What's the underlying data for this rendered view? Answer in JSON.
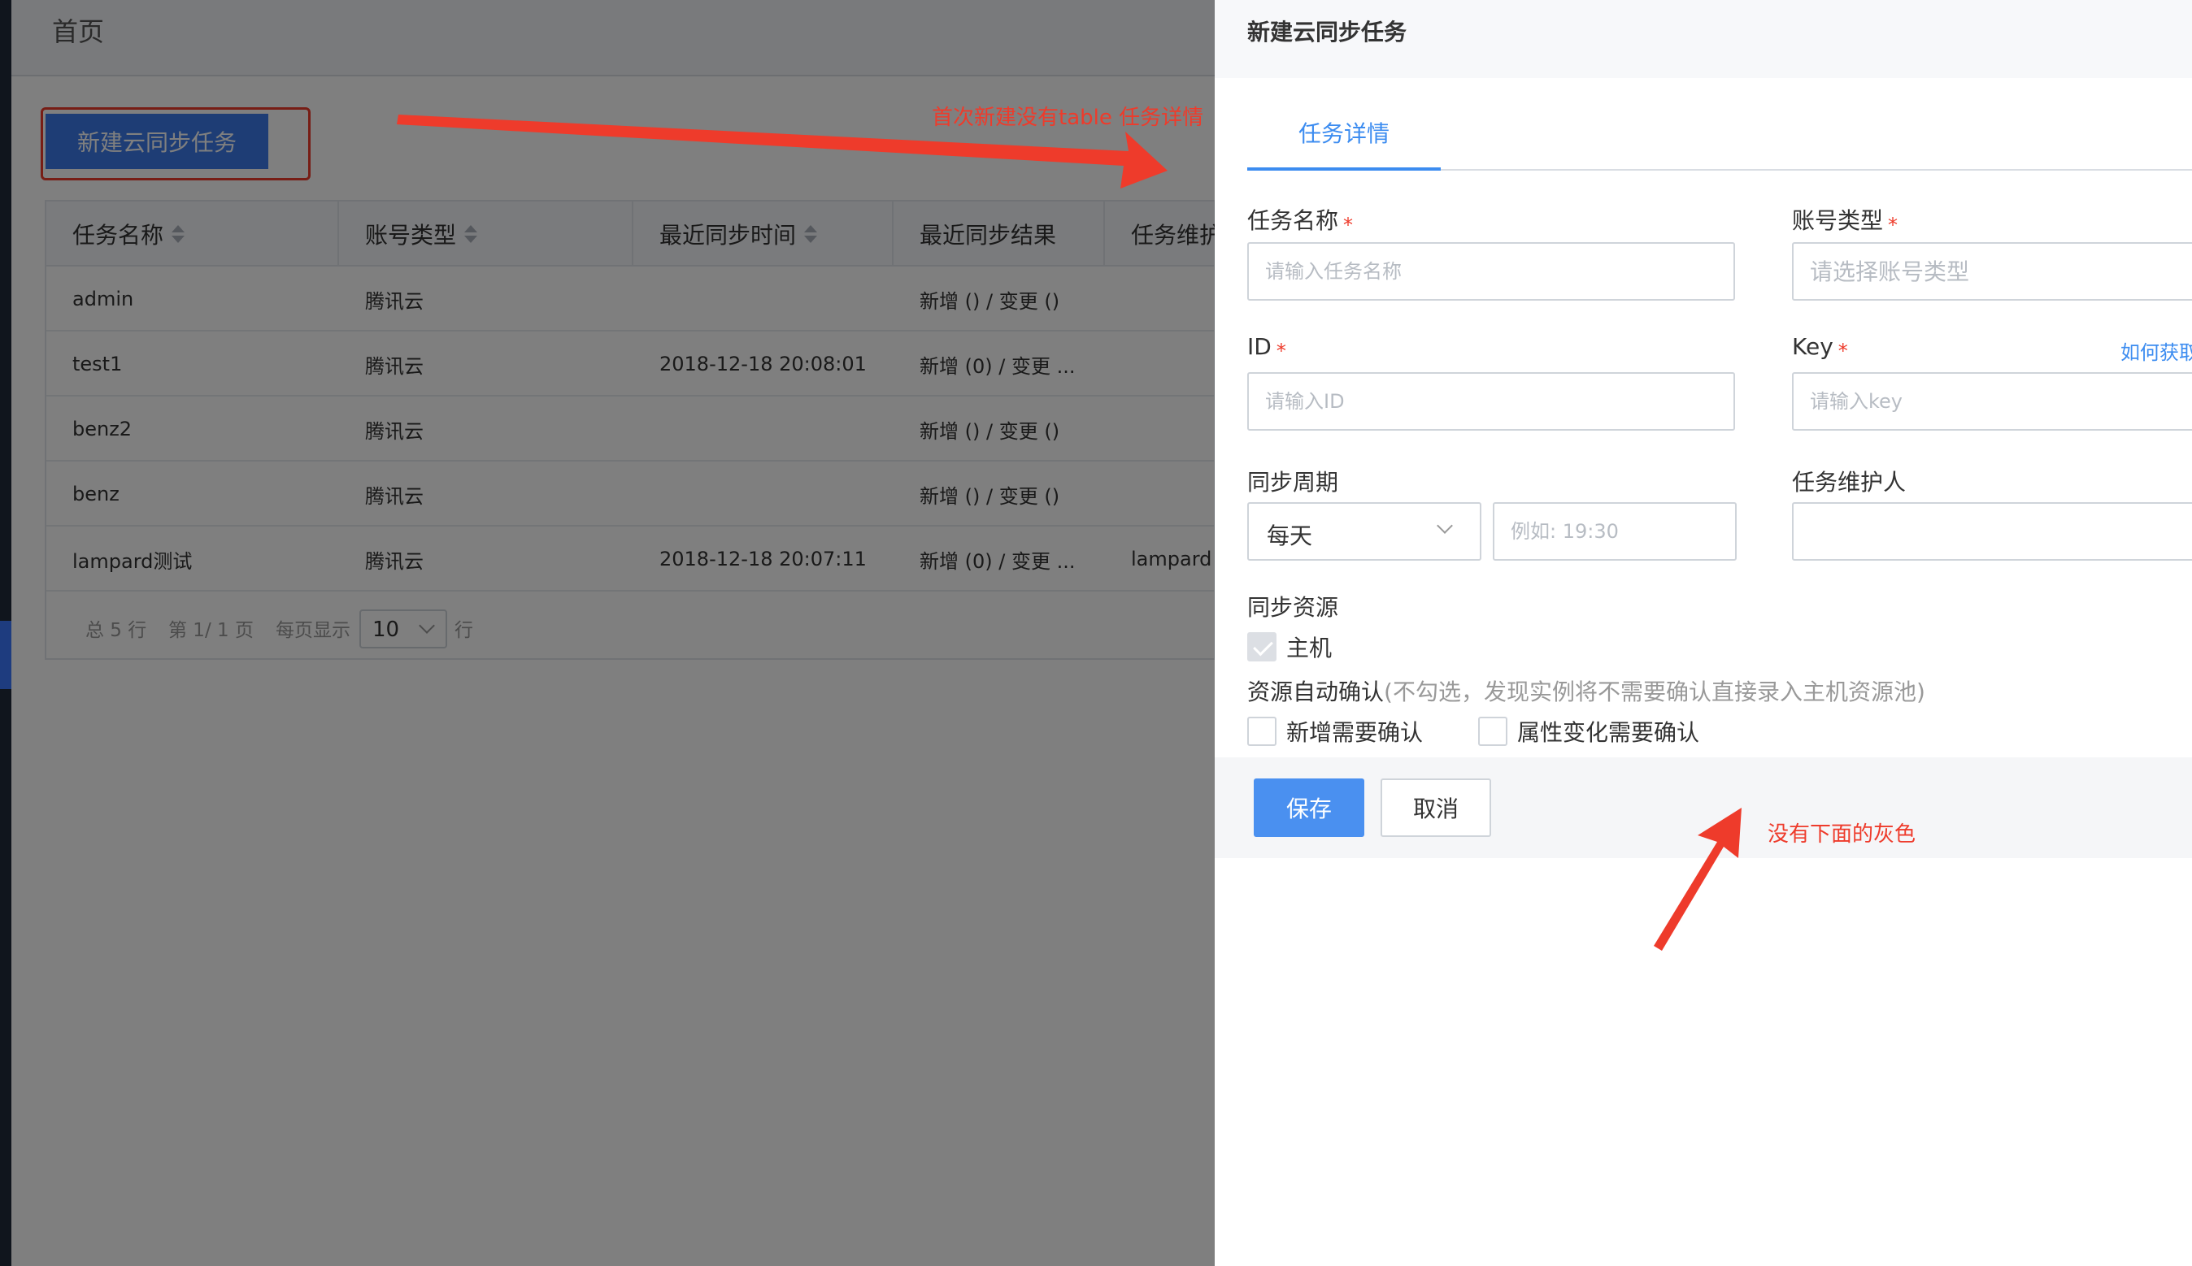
{
  "header": {
    "title": "首页"
  },
  "new_task_button": "新建云同步任务",
  "table": {
    "columns": [
      "任务名称",
      "账号类型",
      "最近同步时间",
      "最近同步结果",
      "任务维护"
    ],
    "rows": [
      {
        "name": "admin",
        "type": "腾讯云",
        "time": "",
        "result": "新增 () / 变更 ()",
        "owner": ""
      },
      {
        "name": "test1",
        "type": "腾讯云",
        "time": "2018-12-18 20:08:01",
        "result": "新增 (0) / 变更 ...",
        "owner": ""
      },
      {
        "name": "benz2",
        "type": "腾讯云",
        "time": "",
        "result": "新增 () / 变更 ()",
        "owner": ""
      },
      {
        "name": "benz",
        "type": "腾讯云",
        "time": "",
        "result": "新增 () / 变更 ()",
        "owner": ""
      },
      {
        "name": "lampard测试",
        "type": "腾讯云",
        "time": "2018-12-18 20:07:11",
        "result": "新增 (0) / 变更 ...",
        "owner": "lampard"
      }
    ],
    "pager": {
      "total": "总 5 行",
      "page": "第 1/ 1 页",
      "per_page_label": "每页显示",
      "per_page_value": "10",
      "unit": "行"
    }
  },
  "annotations": {
    "top": "首次新建没有table 任务详情",
    "bottom": "没有下面的灰色"
  },
  "drawer": {
    "title": "新建云同步任务",
    "tab": "任务详情",
    "fields": {
      "task_name": {
        "label": "任务名称",
        "placeholder": "请输入任务名称"
      },
      "account_type": {
        "label": "账号类型",
        "placeholder": "请选择账号类型"
      },
      "id": {
        "label": "ID",
        "placeholder": "请输入ID"
      },
      "key": {
        "label": "Key",
        "placeholder": "请输入key",
        "help": "如何获取"
      },
      "cycle": {
        "label": "同步周期",
        "value": "每天",
        "time_placeholder": "例如: 19:30"
      },
      "maintainer": {
        "label": "任务维护人",
        "value": ""
      }
    },
    "required_mark": "*",
    "resource": {
      "label": "同步资源",
      "host": "主机"
    },
    "auto_confirm": {
      "label": "资源自动确认",
      "hint": "(不勾选，发现实例将不需要确认直接录入主机资源池)",
      "add_label": "新增需要确认",
      "change_label": "属性变化需要确认"
    },
    "buttons": {
      "save": "保存",
      "cancel": "取消"
    }
  },
  "colors": {
    "accent": "#3c8cf0",
    "annotation": "#ee3b2b",
    "primary_button": "#4a90f0"
  }
}
